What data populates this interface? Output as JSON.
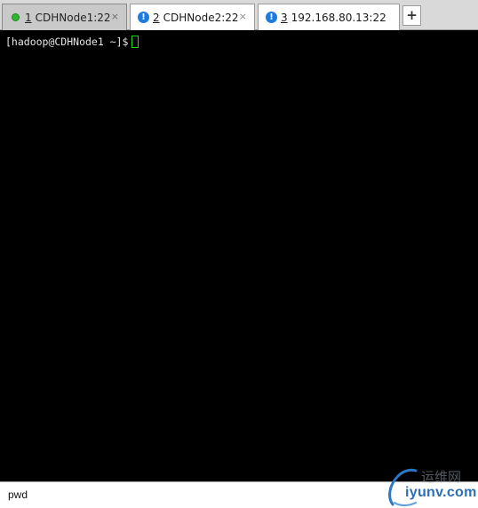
{
  "tabs": [
    {
      "number": "1",
      "label": "CDHNode1:22",
      "status": "connected",
      "status_icon": "green-dot-icon",
      "active": true,
      "close": "×"
    },
    {
      "number": "2",
      "label": "CDHNode2:22",
      "status": "warning",
      "status_icon": "info-alert-icon",
      "active": false,
      "close": "×"
    },
    {
      "number": "3",
      "label": "192.168.80.13:22",
      "status": "warning",
      "status_icon": "info-alert-icon",
      "active": false,
      "close": ""
    }
  ],
  "status_glyph": "!",
  "new_tab_label": "+",
  "terminal": {
    "prompt": "[hadoop@CDHNode1 ~]$",
    "cursor_color": "#22d322",
    "background": "#000000"
  },
  "command_bar": {
    "value": "pwd"
  },
  "watermark": {
    "cn": "运维网",
    "en": "iyunv.com"
  }
}
